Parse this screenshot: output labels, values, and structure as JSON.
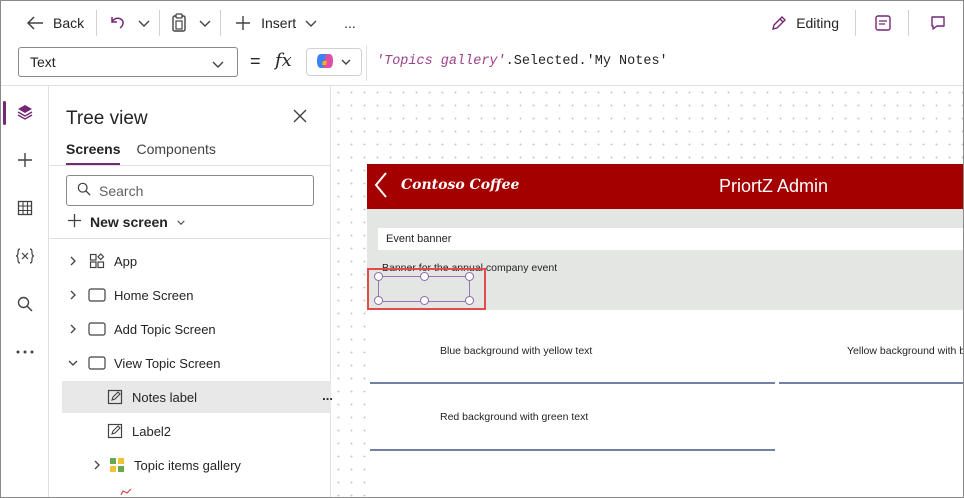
{
  "toolbar": {
    "back_label": "Back",
    "insert_label": "Insert",
    "more_label": "...",
    "editing_label": "Editing"
  },
  "formula_bar": {
    "property": "Text",
    "equals": "=",
    "fx": "fx",
    "formula_string": "'Topics gallery'",
    "formula_tail": ".Selected.'My Notes'"
  },
  "tree": {
    "title": "Tree view",
    "tabs": [
      "Screens",
      "Components"
    ],
    "active_tab": "Screens",
    "search_placeholder": "Search",
    "new_screen_label": "New screen",
    "nodes": [
      {
        "label": "App",
        "icon": "app-icon"
      },
      {
        "label": "Home Screen",
        "icon": "screen-icon"
      },
      {
        "label": "Add Topic Screen",
        "icon": "screen-icon"
      },
      {
        "label": "View Topic Screen",
        "icon": "screen-icon"
      },
      {
        "label": "Notes label",
        "icon": "label-icon"
      },
      {
        "label": "Label2",
        "icon": "label-icon"
      },
      {
        "label": "Topic items gallery",
        "icon": "gallery-icon"
      }
    ],
    "node_more": "..."
  },
  "app_preview": {
    "brand": "Contoso Coffee",
    "title": "PriortZ Admin",
    "event_banner_value": "Event banner",
    "event_description": "Banner for the annual company event",
    "rows": [
      "Blue background with yellow text",
      "Yellow background with b",
      "Red background with green text"
    ]
  },
  "colors": {
    "accent": "#742774",
    "header_red": "#a50000",
    "selection_red": "#e04b4b"
  }
}
